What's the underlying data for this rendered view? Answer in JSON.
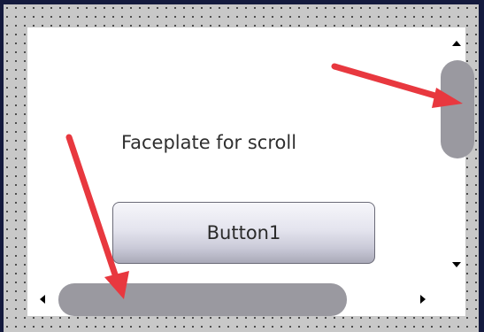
{
  "faceplate": {
    "title": "Faceplate for scroll",
    "button_label": "Button1"
  },
  "scrollbars": {
    "vertical": {
      "position": 0.0
    },
    "horizontal": {
      "position": 0.0
    }
  },
  "icons": {
    "scroll_up": "triangle-up",
    "scroll_down": "triangle-down",
    "scroll_left": "triangle-left",
    "scroll_right": "triangle-right",
    "annotation_arrow": "red-arrow"
  },
  "colors": {
    "outer_frame": "#141a3e",
    "design_grid": "#c8c8c8",
    "faceplate_bg": "#ffffff",
    "scroll_thumb": "#9a99a0",
    "annotation": "#e8383f"
  }
}
